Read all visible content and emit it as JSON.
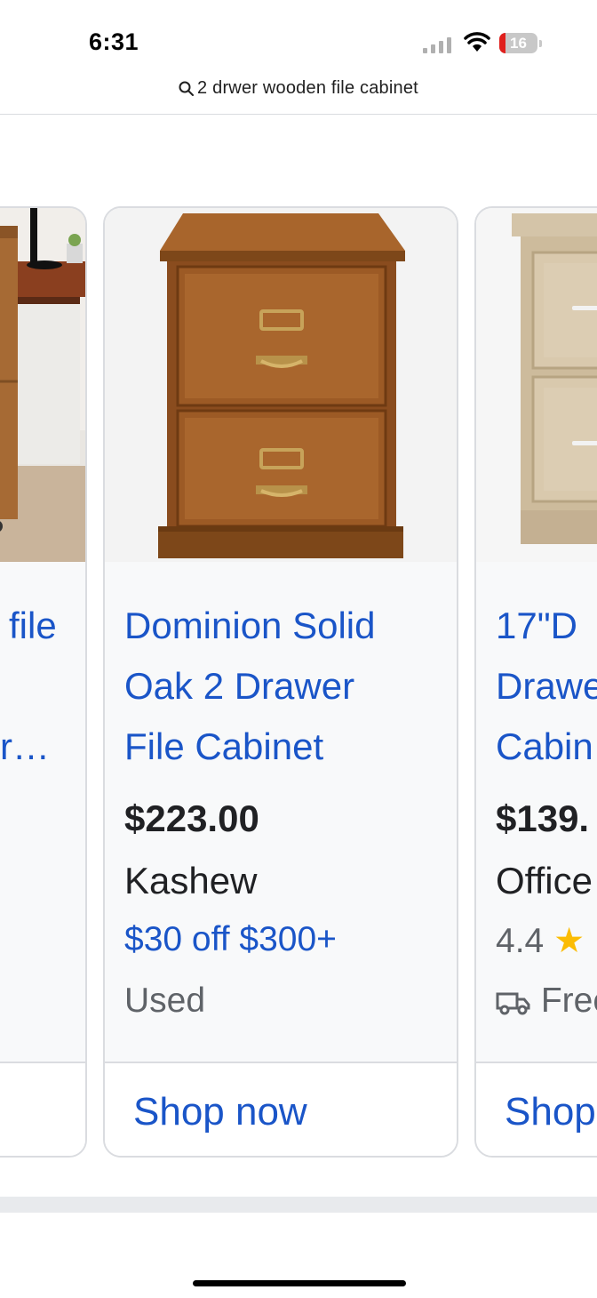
{
  "status_bar": {
    "time": "6:31",
    "battery_level": "16",
    "battery_color": "#e0201d"
  },
  "search": {
    "query": "2 drwer wooden file cabinet",
    "icon": "search-icon"
  },
  "colors": {
    "link": "#1a55c8",
    "star": "#fbbc04"
  },
  "carousel": {
    "cards": [
      {
        "title_fragments": [
          "file",
          "r…"
        ],
        "image": "wood-file-cabinet-on-desk"
      },
      {
        "title": "Dominion Solid Oak 2 Drawer File Cabinet",
        "title_lines": [
          "Dominion Solid",
          "Oak 2 Drawer",
          "File Cabinet"
        ],
        "price": "$223.00",
        "merchant": "Kashew",
        "promo": "$30 off $300+",
        "condition": "Used",
        "cta": "Shop now",
        "image": "oak-two-drawer-file-cabinet"
      },
      {
        "title_lines": [
          "17\"D",
          "Drawe",
          "Cabin"
        ],
        "price": "$139.",
        "merchant": "Office",
        "rating": "4.4",
        "stars": "★",
        "shipping": "Free",
        "cta": "Shop",
        "image": "light-oak-file-cabinet"
      }
    ]
  }
}
